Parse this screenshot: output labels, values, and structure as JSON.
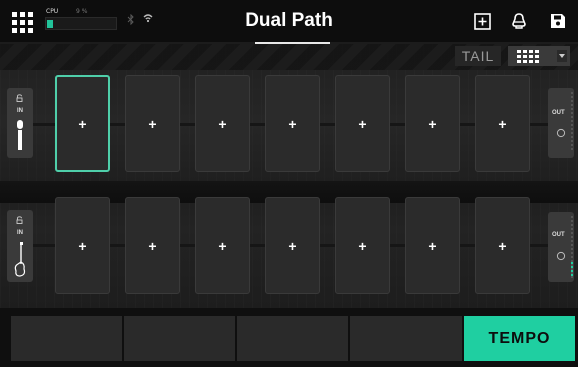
{
  "header": {
    "title": "Dual Path",
    "cpu_label": "CPU",
    "cpu_value": "9 %",
    "cpu_level": 0.09,
    "icons": [
      "menu-grid-icon",
      "bluetooth-icon",
      "wifi-icon",
      "add-square-icon",
      "tuner-icon",
      "save-icon"
    ]
  },
  "controls": {
    "tail_label": "TAIL",
    "grid_view_icon": "grid-view-icon"
  },
  "paths": [
    {
      "in_label": "IN",
      "out_label": "OUT",
      "in_icon": "microphone-icon",
      "slots": [
        "+",
        "+",
        "+",
        "+",
        "+",
        "+",
        "+"
      ]
    },
    {
      "in_label": "IN",
      "out_label": "OUT",
      "in_icon": "guitar-icon",
      "slots": [
        "+",
        "+",
        "+",
        "+",
        "+",
        "+",
        "+"
      ]
    }
  ],
  "footer": {
    "buttons": [
      "",
      "",
      "",
      ""
    ],
    "tempo_label": "TEMPO"
  },
  "colors": {
    "accent": "#1fcfa1",
    "selected_border": "#4fcfaa",
    "background": "#1c1c1c"
  }
}
